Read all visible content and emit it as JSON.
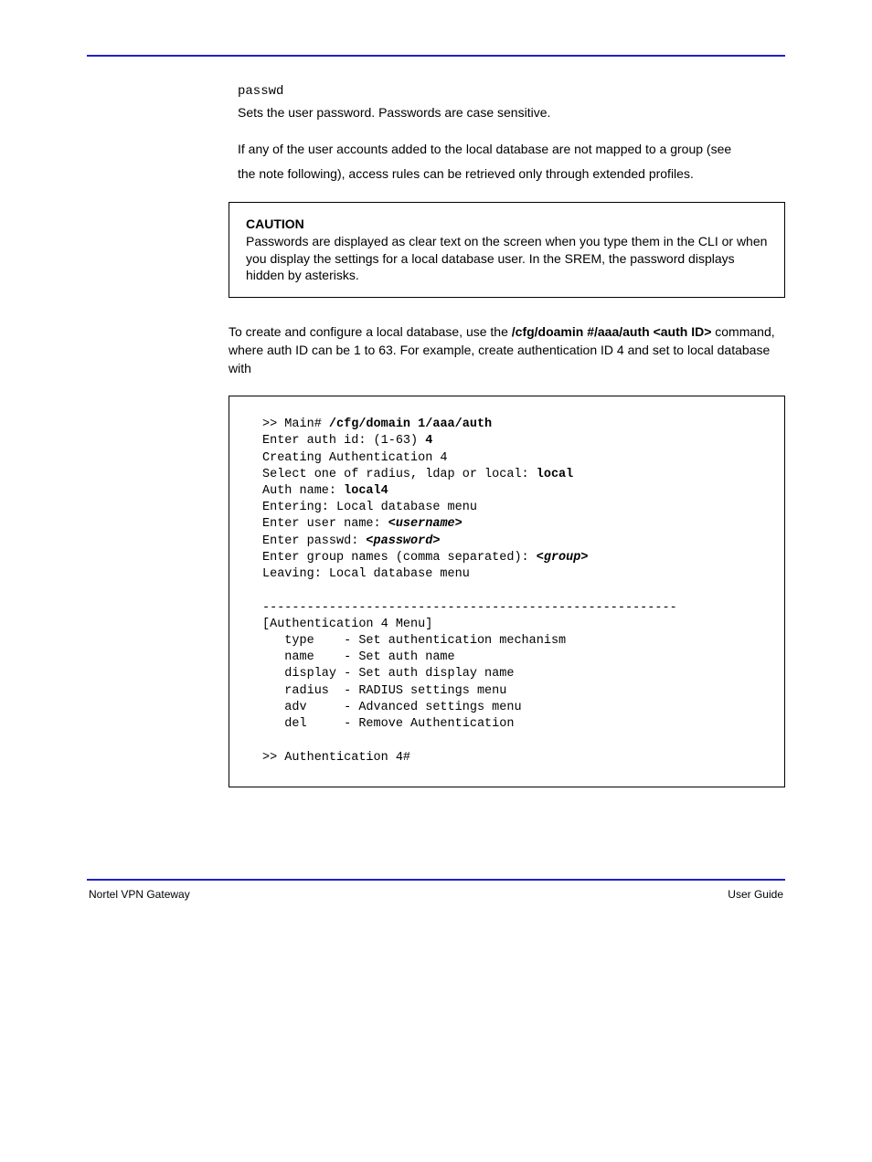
{
  "passwd_label": "passwd",
  "passwd_desc": "Sets the user password. Passwords are case sensitive.",
  "note_text_1": "If any of the user accounts added to the local database are not mapped to a group (see ",
  "note_text_2": "the note following), access rules can be retrieved only through extended profiles.",
  "caution_heading": "CAUTION",
  "caution_body": "Passwords are displayed as clear text on the screen when you type them in the CLI or when you display the settings for a local database user. In the SREM, the password displays hidden by asterisks.",
  "tocreate_1": "To create and configure a local database, use the ",
  "tocreate_cmd": "/cfg/doamin #/aaa/auth <auth ID>",
  "tocreate_2": " command, where auth ID can be 1 to 63. For example, create authentication ID 4 and set to local database with",
  "code": {
    "l1a": ">> Main# ",
    "l1b": "/cfg/domain 1/aaa/auth",
    "l2a": "Enter auth id: (1-63) ",
    "l2b": "4",
    "l3": "Creating Authentication 4",
    "l4a": "Select one of radius, ldap or local: ",
    "l4b": "local",
    "l5a": "Auth name: ",
    "l5b": "local4",
    "l6": "Entering: Local database menu",
    "l7a": "Enter user name: ",
    "l7b": "<username>",
    "l8a": "Enter passwd: ",
    "l8b": "<password>",
    "l9a": "Enter group names (comma separated): ",
    "l9b": "<group>",
    "l10": "Leaving: Local database menu",
    "dash": "--------------------------------------------------------",
    "m1": "[Authentication 4 Menu]",
    "m2": "   type    - Set authentication mechanism",
    "m3": "   name    - Set auth name",
    "m4": "   display - Set auth display name",
    "m5": "   radius  - RADIUS settings menu",
    "m6": "   adv     - Advanced settings menu",
    "m7": "   del     - Remove Authentication",
    "m8": ">> Authentication 4#"
  },
  "footer_left": "Nortel VPN Gateway",
  "footer_right": "User Guide"
}
